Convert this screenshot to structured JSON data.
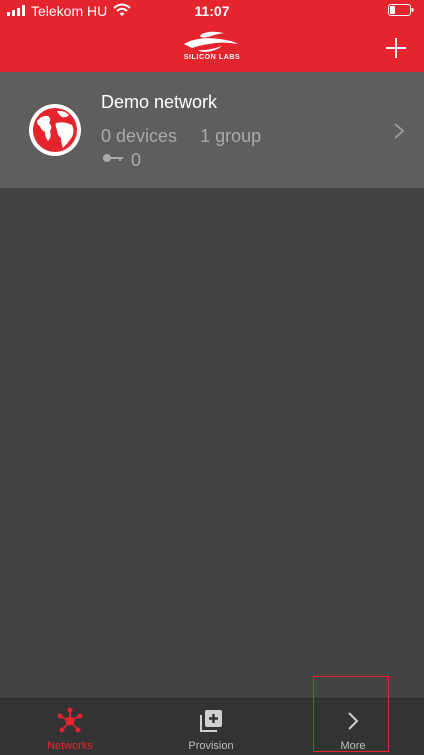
{
  "status_bar": {
    "carrier": "Telekom HU",
    "time": "11:07"
  },
  "header": {
    "logo_text": "SILICON LABS"
  },
  "networks": [
    {
      "name": "Demo network",
      "devices": "0 devices",
      "groups": "1 group",
      "keys": "0"
    }
  ],
  "tabs": [
    {
      "label": "Networks",
      "icon": "network-icon",
      "active": true
    },
    {
      "label": "Provision",
      "icon": "provision-icon",
      "active": false
    },
    {
      "label": "More",
      "icon": "chevron-right-icon",
      "active": false
    }
  ],
  "colors": {
    "accent": "#e5252e",
    "background": "#434343",
    "row": "#5e5e5e",
    "tabbar": "#333333"
  }
}
